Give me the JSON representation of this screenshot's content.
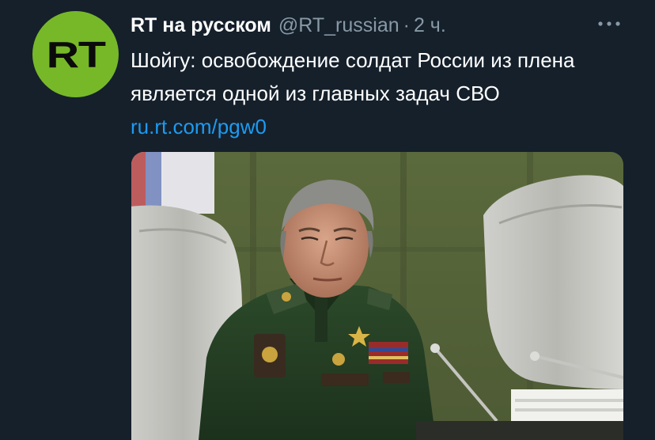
{
  "avatar": {
    "text": "RT",
    "color": "#77b829"
  },
  "author": {
    "display_name": "RT на русском",
    "handle": "@RT_russian",
    "separator": "·",
    "time": "2 ч."
  },
  "more_icon": "more-horizontal-icon",
  "tweet": {
    "text": "Шойгу: освобождение солдат России из плена является одной из главных задач СВО",
    "link": "ru.rt.com/pgw0"
  },
  "colors": {
    "background": "#15202b",
    "text": "#ffffff",
    "muted": "#8899a6",
    "link": "#1d9bf0"
  }
}
